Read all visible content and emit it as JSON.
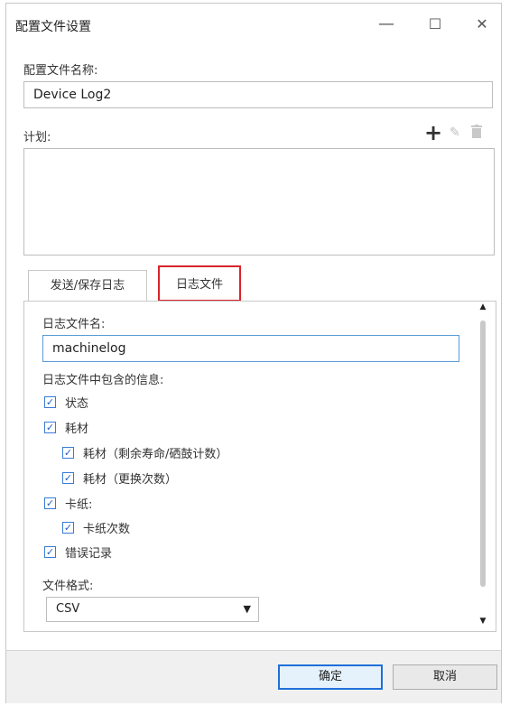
{
  "window": {
    "title": "配置文件设置",
    "minimize_glyph": "—",
    "maximize_glyph": "☐",
    "close_glyph": "✕"
  },
  "profile": {
    "name_label": "配置文件名称:",
    "name_value": "Device Log2"
  },
  "plan": {
    "label": "计划:",
    "add_icon": "plus-icon",
    "edit_icon": "pencil-icon",
    "delete_icon": "trash-icon"
  },
  "tabs": [
    {
      "label": "发送/保存日志",
      "active": false
    },
    {
      "label": "日志文件",
      "active": true
    }
  ],
  "log_file": {
    "name_label": "日志文件名:",
    "name_value": "machinelog",
    "info_label": "日志文件中包含的信息:",
    "items": [
      {
        "label": "状态",
        "checked": true,
        "level": 0
      },
      {
        "label": "耗材",
        "checked": true,
        "level": 0
      },
      {
        "label": "耗材（剩余寿命/硒鼓计数）",
        "checked": true,
        "level": 1
      },
      {
        "label": "耗材（更换次数）",
        "checked": true,
        "level": 1
      },
      {
        "label": "卡纸:",
        "checked": true,
        "level": 0
      },
      {
        "label": "卡纸次数",
        "checked": true,
        "level": 1
      },
      {
        "label": "错误记录",
        "checked": true,
        "level": 0
      }
    ],
    "format_label": "文件格式:",
    "format_value": "CSV"
  },
  "footer": {
    "ok_label": "确定",
    "cancel_label": "取消"
  },
  "colors": {
    "active_tab_highlight": "#d9242c",
    "ok_button_border": "#1e6fd9"
  }
}
